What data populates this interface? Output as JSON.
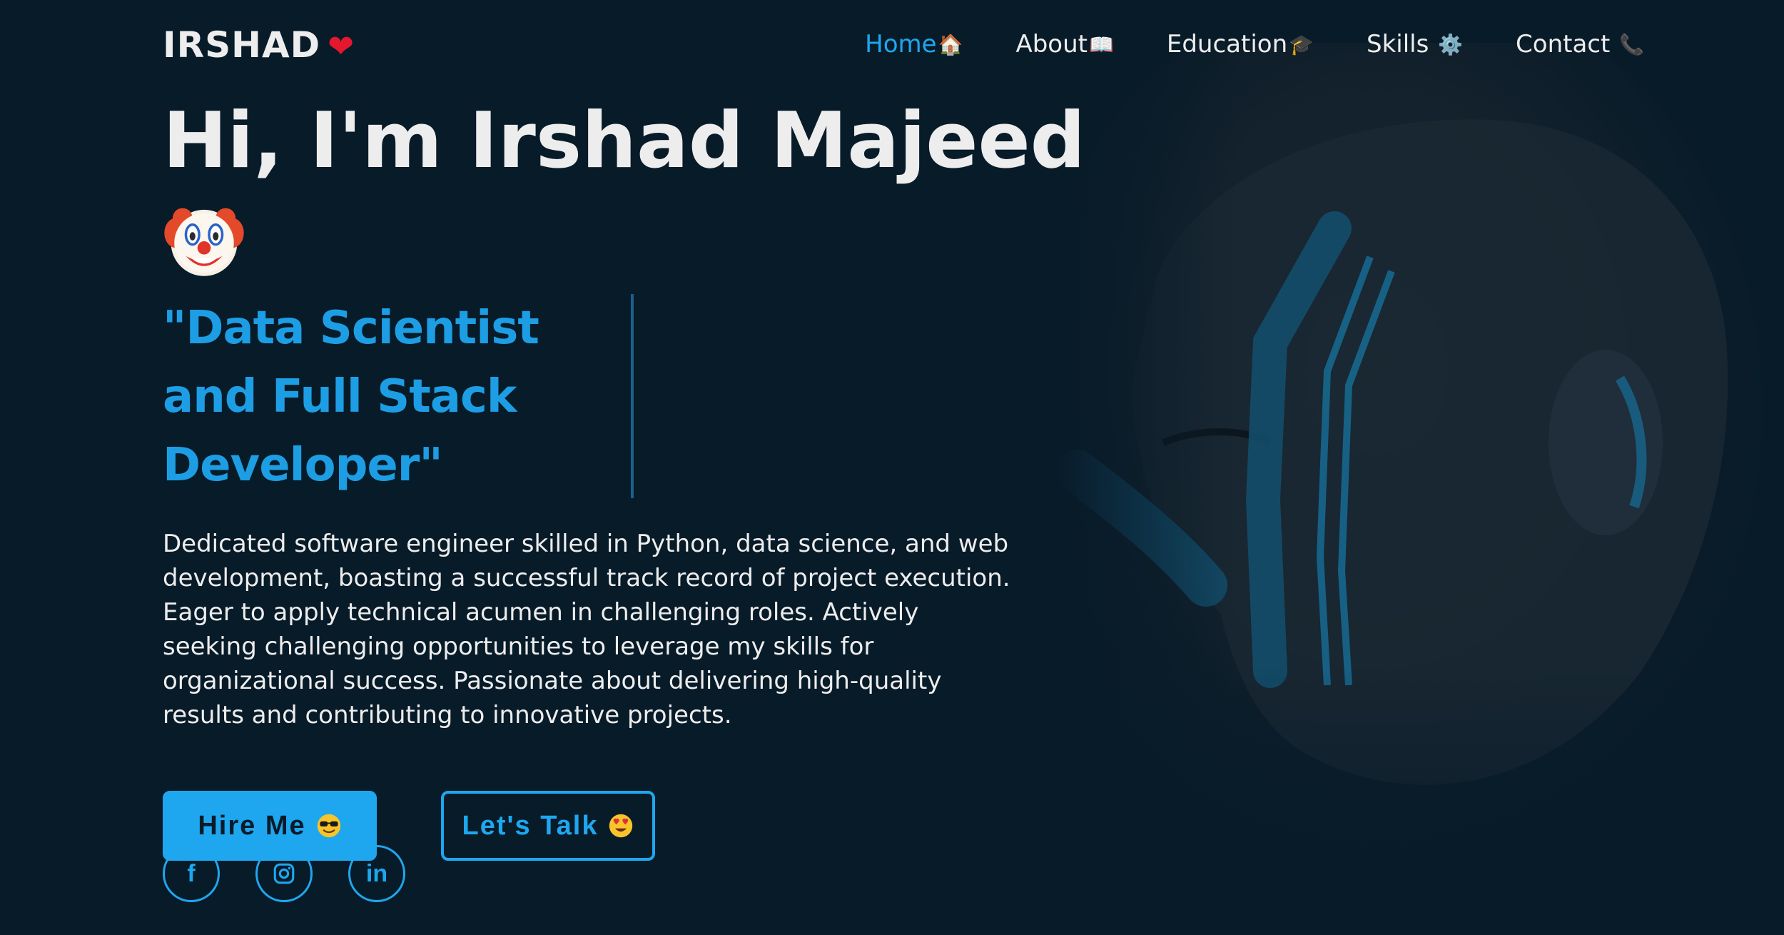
{
  "header": {
    "logo": "IRSHAD",
    "logo_heart": "❤",
    "nav": [
      {
        "label": "Home",
        "emoji": "🏠",
        "active": true
      },
      {
        "label": "About",
        "emoji": "📖",
        "active": false
      },
      {
        "label": "Education",
        "emoji": "🎓",
        "active": false
      },
      {
        "label": "Skills",
        "emoji": "⚙️",
        "active": false
      },
      {
        "label": "Contact",
        "emoji": "📞",
        "active": false
      }
    ]
  },
  "hero": {
    "title": "Hi, I'm Irshad Majeed",
    "title_emoji": "clown-face-icon",
    "subtitle": "\"Data Scientist and Full Stack Developer\"",
    "description": "Dedicated software engineer skilled in Python, data science, and web development, boasting a successful track record of project execution. Eager to apply technical acumen in challenging roles. Actively seeking challenging opportunities to leverage my skills for organizational success. Passionate about delivering high-quality results and contributing to innovative projects."
  },
  "buttons": {
    "hire": "Hire Me",
    "talk": "Let's Talk"
  },
  "socials": {
    "facebook": "f",
    "instagram": "instagram-icon",
    "linkedin": "in"
  },
  "colors": {
    "background": "#081b29",
    "accent": "#1ea7ef",
    "text": "#ededed",
    "heart": "#e3182f"
  }
}
